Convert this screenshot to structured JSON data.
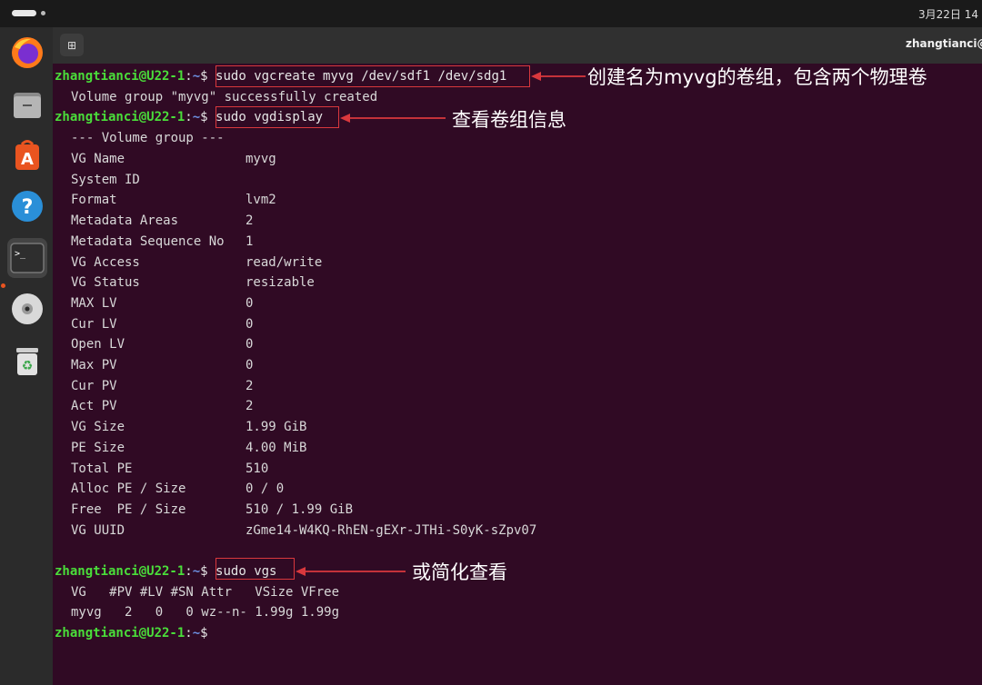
{
  "topbar": {
    "clock": "3月22日 14"
  },
  "dock": {
    "items": [
      {
        "name": "firefox-icon"
      },
      {
        "name": "files-icon"
      },
      {
        "name": "app-center-icon"
      },
      {
        "name": "help-icon"
      },
      {
        "name": "terminal-icon"
      },
      {
        "name": "disc-icon"
      },
      {
        "name": "trash-icon"
      }
    ],
    "terminal_symbol": ">_"
  },
  "window": {
    "title": "zhangtianci@U",
    "new_tab_symbol": "⊞"
  },
  "prompt": {
    "user": "zhangtianci@U22-1",
    "sep": ":",
    "path": "~",
    "symbol": "$"
  },
  "commands": {
    "vgcreate": "sudo vgcreate myvg /dev/sdf1 /dev/sdg1",
    "vgcreate_output": "Volume group \"myvg\" successfully created",
    "vgdisplay": "sudo vgdisplay",
    "vgs": "sudo vgs"
  },
  "vgdisplay": {
    "header": "--- Volume group ---",
    "rows": [
      {
        "key": "VG Name",
        "value": "myvg"
      },
      {
        "key": "System ID",
        "value": ""
      },
      {
        "key": "Format",
        "value": "lvm2"
      },
      {
        "key": "Metadata Areas",
        "value": "2"
      },
      {
        "key": "Metadata Sequence No",
        "value": "1"
      },
      {
        "key": "VG Access",
        "value": "read/write"
      },
      {
        "key": "VG Status",
        "value": "resizable"
      },
      {
        "key": "MAX LV",
        "value": "0"
      },
      {
        "key": "Cur LV",
        "value": "0"
      },
      {
        "key": "Open LV",
        "value": "0"
      },
      {
        "key": "Max PV",
        "value": "0"
      },
      {
        "key": "Cur PV",
        "value": "2"
      },
      {
        "key": "Act PV",
        "value": "2"
      },
      {
        "key": "VG Size",
        "value": "1.99 GiB"
      },
      {
        "key": "PE Size",
        "value": "4.00 MiB"
      },
      {
        "key": "Total PE",
        "value": "510"
      },
      {
        "key": "Alloc PE / Size",
        "value": "0 / 0"
      },
      {
        "key": "Free  PE / Size",
        "value": "510 / 1.99 GiB"
      },
      {
        "key": "VG UUID",
        "value": "zGme14-W4KQ-RhEN-gEXr-JTHi-S0yK-sZpv07"
      }
    ]
  },
  "vgs": {
    "header": "VG   #PV #LV #SN Attr   VSize VFree",
    "row": "myvg   2   0   0 wz--n- 1.99g 1.99g"
  },
  "annotations": {
    "vgcreate": "创建名为myvg的卷组，包含两个物理卷",
    "vgdisplay": "查看卷组信息",
    "vgs": "或简化查看"
  },
  "colors": {
    "background": "#300a24",
    "prompt_user": "#4ade3a",
    "prompt_path": "#6c8fe0",
    "highlight": "#d9383d"
  }
}
